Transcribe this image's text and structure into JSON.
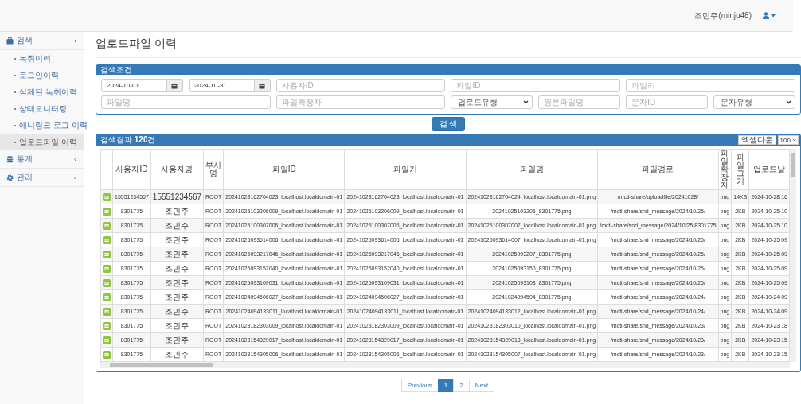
{
  "header": {
    "user": "조민주(minju48)"
  },
  "sidebar": {
    "items": [
      {
        "label": "검색",
        "children": [
          {
            "label": "녹취이력",
            "selected": false
          },
          {
            "label": "로그인이력",
            "selected": false
          },
          {
            "label": "삭제된 녹취이력",
            "selected": false
          },
          {
            "label": "상태모니터링",
            "selected": false
          },
          {
            "label": "애니링크 로그 이력",
            "selected": false
          },
          {
            "label": "업로드파일 이력",
            "selected": true
          }
        ]
      },
      {
        "label": "통계"
      },
      {
        "label": "관리"
      }
    ]
  },
  "page_title": "업로드파일 이력",
  "search_form": {
    "title": "검색조건",
    "fields": [
      {
        "kind": "date",
        "value": "2024-10-01"
      },
      {
        "kind": "date",
        "value": "2024-10-31"
      },
      {
        "kind": "text",
        "placeholder": "사용자ID"
      },
      {
        "kind": "text",
        "placeholder": "파일ID"
      },
      {
        "kind": "text",
        "placeholder": "파일키"
      },
      {
        "kind": "text",
        "placeholder": "파일명"
      },
      {
        "kind": "text",
        "placeholder": "파일확장자"
      },
      {
        "kind": "select",
        "value": "업로드유형"
      },
      {
        "kind": "narrow_text",
        "placeholder": "원본파일명"
      },
      {
        "kind": "narrow_text",
        "placeholder": "문자ID"
      },
      {
        "kind": "select",
        "value": "문자유형"
      }
    ],
    "button": "검 색"
  },
  "results": {
    "title": "검색결과 **120**건",
    "excel_button": "엑셀다운",
    "page_size": "100",
    "columns": [
      "사용자ID",
      "사용자명",
      "부서명",
      "파일ID",
      "파일키",
      "파일명",
      "파일경로",
      "파일확장자",
      "파일크기",
      "업로드날"
    ],
    "rows": [
      [
        "15551234567",
        "15551234567",
        "ROOT",
        "20241028162704023_localhost.localdomain-01",
        "20241028162704023_localhost.localdomain-01",
        "20241028162704024_localhost.localdomain-01.png",
        "/mcti-share/uploadfile/20241028/",
        "png",
        "14KB",
        "2024-10-28 16"
      ],
      [
        "8301775",
        "조민주",
        "ROOT",
        "20241025103206009_localhost.localdomain-01",
        "20241025103206009_localhost.localdomain-01",
        "20241025103205_8301775.png",
        "/mcti-share/snd_message/2024/10/25/",
        "png",
        "2KB",
        "2024-10-25 10"
      ],
      [
        "8301775",
        "조민주",
        "ROOT",
        "20241025100307006_localhost.localdomain-01",
        "20241025100307006_localhost.localdomain-01",
        "20241025100307007_localhost.localdomain-01.png",
        "/mcti-share/snd_message/2024/10/25/8301775",
        "png",
        "2KB",
        "2024-10-25 10"
      ],
      [
        "8301775",
        "조민주",
        "ROOT",
        "20241025093614006_localhost.localdomain-01",
        "20241025093614006_localhost.localdomain-01",
        "20241025093614007_localhost.localdomain-01.png",
        "/mcti-share/snd_message/2024/10/25/",
        "png",
        "2KB",
        "2024-10-25 09"
      ],
      [
        "8301775",
        "조민주",
        "ROOT",
        "20241025093217046_localhost.localdomain-01",
        "20241025093217046_localhost.localdomain-01",
        "20241025093207_8301775.png",
        "/mcti-share/snd_message/2024/10/25/",
        "png",
        "2KB",
        "2024-10-25 09"
      ],
      [
        "8301775",
        "조민주",
        "ROOT",
        "20241025093152040_localhost.localdomain-01",
        "20241025093152040_localhost.localdomain-01",
        "20241025093150_8301775.png",
        "/mcti-share/snd_message/2024/10/25/",
        "png",
        "2KB",
        "2024-10-25 09"
      ],
      [
        "8301775",
        "조민주",
        "ROOT",
        "20241025093109031_localhost.localdomain-01",
        "20241025093109031_localhost.localdomain-01",
        "20241025093108_8301775.png",
        "/mcti-share/snd_message/2024/10/25/",
        "png",
        "2KB",
        "2024-10-25 09"
      ],
      [
        "8301775",
        "조민주",
        "ROOT",
        "20241024094506027_localhost.localdomain-01",
        "20241024094506027_localhost.localdomain-01",
        "20241024094504_8301775.png",
        "/mcti-share/snd_message/2024/10/24/",
        "png",
        "2KB",
        "2024-10-24 09"
      ],
      [
        "8301775",
        "조민주",
        "ROOT",
        "20241024094133011_localhost.localdomain-01",
        "20241024094133011_localhost.localdomain-01",
        "20241024094133012_localhost.localdomain-01.png",
        "/mcti-share/snd_message/2024/10/24/",
        "png",
        "2KB",
        "2024-10-24 09"
      ],
      [
        "8301775",
        "조민주",
        "ROOT",
        "20241023182303009_localhost.localdomain-01",
        "20241023182303009_localhost.localdomain-01",
        "20241023182303010_localhost.localdomain-01.png",
        "/mcti-share/snd_message/2024/10/23/",
        "png",
        "2KB",
        "2024-10-23 18"
      ],
      [
        "8301775",
        "조민주",
        "ROOT",
        "20241023154329017_localhost.localdomain-01",
        "20241023154329017_localhost.localdomain-01",
        "20241023154329018_localhost.localdomain-01.png",
        "/mcti-share/snd_message/2024/10/23/",
        "png",
        "2KB",
        "2024-10-23 15"
      ],
      [
        "8301775",
        "조민주",
        "ROOT",
        "20241023154305006_localhost.localdomain-01",
        "20241023154305006_localhost.localdomain-01",
        "20241023154305007_localhost.localdomain-01.png",
        "/mcti-share/snd_message/2024/10/23/",
        "png",
        "2KB",
        "2024-10-23 15"
      ]
    ]
  },
  "pagination": {
    "previous": "Previous",
    "pages": [
      {
        "label": "1",
        "selected": true
      },
      {
        "label": "2",
        "selected": false
      }
    ],
    "next": "Next"
  }
}
